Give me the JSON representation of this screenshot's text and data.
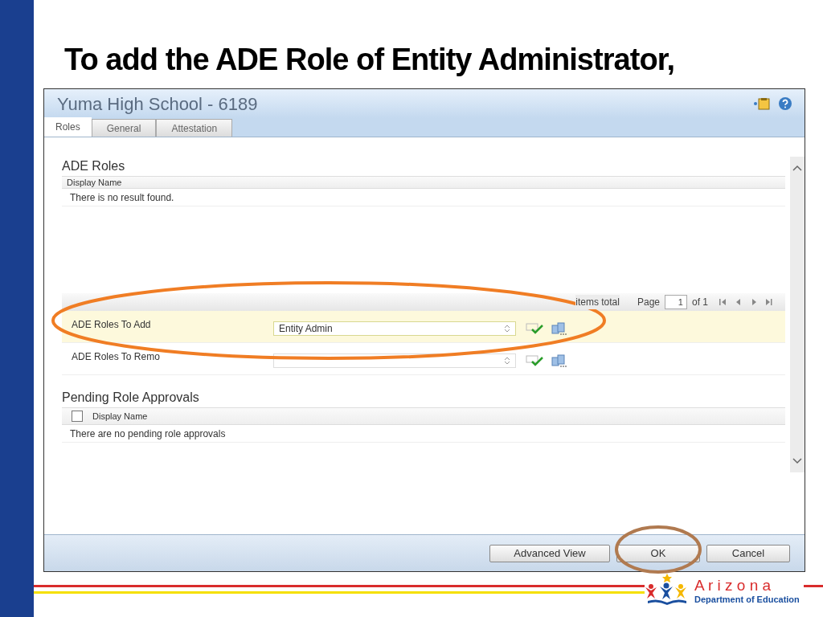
{
  "slide_title": "To add the ADE Role of Entity Administrator,",
  "window": {
    "title": "Yuma High School - 6189"
  },
  "tabs": [
    {
      "label": "Roles",
      "selected": true
    },
    {
      "label": "General",
      "selected": false
    },
    {
      "label": "Attestation",
      "selected": false
    }
  ],
  "ade_roles": {
    "title": "ADE Roles",
    "column": "Display Name",
    "empty_text": "There is no result found."
  },
  "pager": {
    "items_total": "items total",
    "page_label": "Page",
    "page": "1",
    "of": "of 1"
  },
  "role_rows": [
    {
      "label": "ADE Roles To Add",
      "value": "Entity Admin",
      "highlighted": true
    },
    {
      "label": "ADE Roles To Remo",
      "value": "",
      "highlighted": false
    }
  ],
  "pending": {
    "title": "Pending Role Approvals",
    "checked": false,
    "column": "Display Name",
    "empty_text": "There are no pending role approvals"
  },
  "buttons": [
    "Advanced View",
    "OK",
    "Cancel"
  ],
  "logo": {
    "name": "A r i z o n a",
    "subtitle": "Department of Education"
  }
}
